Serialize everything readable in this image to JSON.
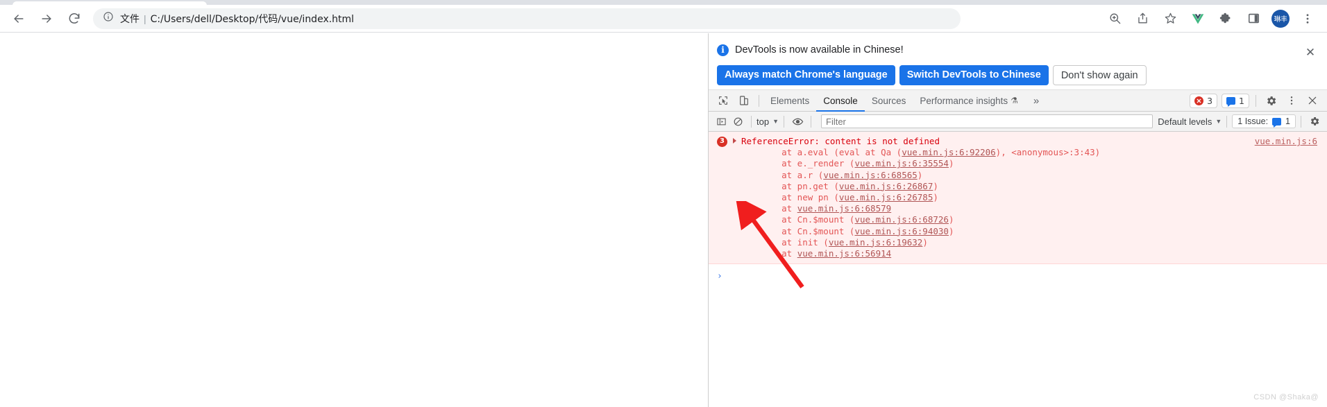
{
  "browser": {
    "nav": {
      "back_label": "Back",
      "forward_label": "Forward",
      "reload_label": "Reload"
    },
    "omnibox": {
      "scheme_label": "文件",
      "separator": "|",
      "url": "C:/Users/dell/Desktop/代码/vue/index.html",
      "info_icon": "info-circle-icon"
    },
    "toolbar_right": {
      "zoom_icon": "zoom-in-icon",
      "share_icon": "share-icon",
      "bookmark_icon": "star-outline-icon",
      "vue_icon": "vue-extension-icon",
      "extensions_icon": "puzzle-piece-icon",
      "side_panel_icon": "side-panel-icon",
      "avatar_label": "琳丰",
      "menu_icon": "three-dot-menu-icon"
    }
  },
  "devtools": {
    "language_banner": {
      "message": "DevTools is now available in Chinese!",
      "primary_button_1": "Always match Chrome's language",
      "primary_button_2": "Switch DevTools to Chinese",
      "secondary_button": "Don't show again",
      "close_icon": "close-icon",
      "info_icon": "info-icon",
      "info_glyph": "i",
      "close_glyph": "✕"
    },
    "tabbar": {
      "inspect_icon": "inspect-element-icon",
      "device_icon": "device-toolbar-icon",
      "tabs": [
        {
          "label": "Elements",
          "active": false
        },
        {
          "label": "Console",
          "active": true
        },
        {
          "label": "Sources",
          "active": false
        },
        {
          "label": "Performance insights",
          "active": false,
          "flask": "⚗"
        }
      ],
      "overflow_label": "»",
      "error_count": "3",
      "message_count": "1",
      "settings_icon": "gear-icon",
      "more_icon": "three-dot-menu-icon",
      "close_icon": "close-icon",
      "close_glyph": "✕"
    },
    "console_toolbar": {
      "sidebar_icon": "console-sidebar-icon",
      "clear_icon": "clear-console-icon",
      "context_selector": "top",
      "caret_glyph": "▼",
      "eye_icon": "live-expression-eye-icon",
      "filter_placeholder": "Filter",
      "filter_value": "",
      "levels_selector": "Default levels",
      "issues_label": "1 Issue:",
      "issues_count": "1",
      "settings_icon": "gear-icon"
    },
    "console": {
      "error_badge_count": "3",
      "error_title": "ReferenceError: content is not defined",
      "source_link": "vue.min.js:6",
      "stack": [
        {
          "prefix": "    at a.eval (eval at Qa (",
          "link": "vue.min.js:6:92206",
          "suffix": "), <anonymous>:3:43)"
        },
        {
          "prefix": "    at e._render (",
          "link": "vue.min.js:6:35554",
          "suffix": ")"
        },
        {
          "prefix": "    at a.r (",
          "link": "vue.min.js:6:68565",
          "suffix": ")"
        },
        {
          "prefix": "    at pn.get (",
          "link": "vue.min.js:6:26867",
          "suffix": ")"
        },
        {
          "prefix": "    at new pn (",
          "link": "vue.min.js:6:26785",
          "suffix": ")"
        },
        {
          "prefix": "    at ",
          "link": "vue.min.js:6:68579",
          "suffix": ""
        },
        {
          "prefix": "    at Cn.$mount (",
          "link": "vue.min.js:6:68726",
          "suffix": ")"
        },
        {
          "prefix": "    at Cn.$mount (",
          "link": "vue.min.js:6:94030",
          "suffix": ")"
        },
        {
          "prefix": "    at init (",
          "link": "vue.min.js:6:19632",
          "suffix": ")"
        },
        {
          "prefix": "    at ",
          "link": "vue.min.js:6:56914",
          "suffix": ""
        }
      ],
      "prompt_glyph": "›"
    }
  },
  "annotation": {
    "arrow_color": "#f01e1e",
    "arrow_name": "red-pointer-arrow"
  },
  "watermark": "CSDN @Shaka@",
  "colors": {
    "accent_blue": "#1a73e8",
    "error_red": "#d93025",
    "error_bg": "#fff0f0",
    "chrome_gray": "#f1f3f4"
  }
}
